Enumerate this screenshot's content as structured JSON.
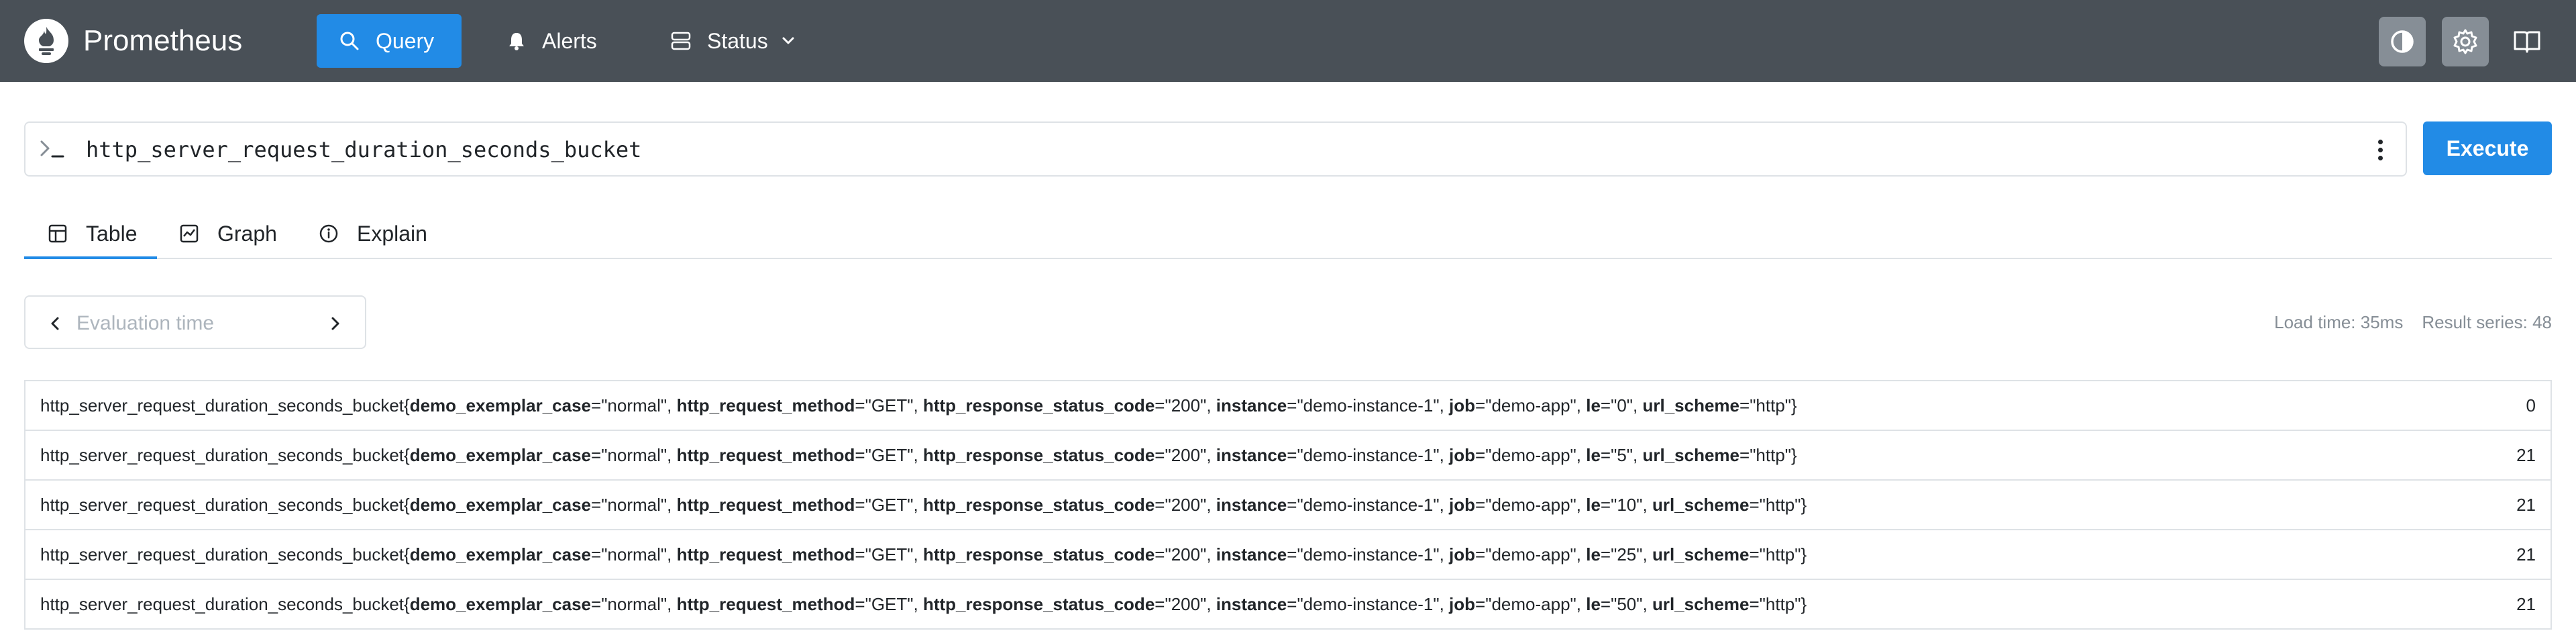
{
  "header": {
    "brand": "Prometheus",
    "nav": {
      "query": "Query",
      "alerts": "Alerts",
      "status": "Status"
    },
    "icons": [
      "prometheus-logo",
      "search-icon",
      "bell-icon",
      "server-icon",
      "chevron-down-icon",
      "theme-toggle-icon",
      "gear-icon",
      "book-icon"
    ]
  },
  "query": {
    "expression": "http_server_request_duration_seconds_bucket",
    "execute_label": "Execute"
  },
  "tabs": [
    {
      "label": "Table",
      "active": true
    },
    {
      "label": "Graph",
      "active": false
    },
    {
      "label": "Explain",
      "active": false
    }
  ],
  "eval_time": {
    "placeholder": "Evaluation time"
  },
  "stats": {
    "load_time": "Load time: 35ms",
    "result_series": "Result series: 48"
  },
  "results": [
    {
      "metric": "http_server_request_duration_seconds_bucket",
      "labels": [
        [
          "demo_exemplar_case",
          "\"normal\""
        ],
        [
          "http_request_method",
          "\"GET\""
        ],
        [
          "http_response_status_code",
          "\"200\""
        ],
        [
          "instance",
          "\"demo-instance-1\""
        ],
        [
          "job",
          "\"demo-app\""
        ],
        [
          "le",
          "\"0\""
        ],
        [
          "url_scheme",
          "\"http\""
        ]
      ],
      "value": "0"
    },
    {
      "metric": "http_server_request_duration_seconds_bucket",
      "labels": [
        [
          "demo_exemplar_case",
          "\"normal\""
        ],
        [
          "http_request_method",
          "\"GET\""
        ],
        [
          "http_response_status_code",
          "\"200\""
        ],
        [
          "instance",
          "\"demo-instance-1\""
        ],
        [
          "job",
          "\"demo-app\""
        ],
        [
          "le",
          "\"5\""
        ],
        [
          "url_scheme",
          "\"http\""
        ]
      ],
      "value": "21"
    },
    {
      "metric": "http_server_request_duration_seconds_bucket",
      "labels": [
        [
          "demo_exemplar_case",
          "\"normal\""
        ],
        [
          "http_request_method",
          "\"GET\""
        ],
        [
          "http_response_status_code",
          "\"200\""
        ],
        [
          "instance",
          "\"demo-instance-1\""
        ],
        [
          "job",
          "\"demo-app\""
        ],
        [
          "le",
          "\"10\""
        ],
        [
          "url_scheme",
          "\"http\""
        ]
      ],
      "value": "21"
    },
    {
      "metric": "http_server_request_duration_seconds_bucket",
      "labels": [
        [
          "demo_exemplar_case",
          "\"normal\""
        ],
        [
          "http_request_method",
          "\"GET\""
        ],
        [
          "http_response_status_code",
          "\"200\""
        ],
        [
          "instance",
          "\"demo-instance-1\""
        ],
        [
          "job",
          "\"demo-app\""
        ],
        [
          "le",
          "\"25\""
        ],
        [
          "url_scheme",
          "\"http\""
        ]
      ],
      "value": "21"
    },
    {
      "metric": "http_server_request_duration_seconds_bucket",
      "labels": [
        [
          "demo_exemplar_case",
          "\"normal\""
        ],
        [
          "http_request_method",
          "\"GET\""
        ],
        [
          "http_response_status_code",
          "\"200\""
        ],
        [
          "instance",
          "\"demo-instance-1\""
        ],
        [
          "job",
          "\"demo-app\""
        ],
        [
          "le",
          "\"50\""
        ],
        [
          "url_scheme",
          "\"http\""
        ]
      ],
      "value": "21"
    }
  ],
  "colors": {
    "header_bg": "#495057",
    "accent": "#228be6",
    "border": "#dee2e6",
    "muted": "#868e96"
  }
}
